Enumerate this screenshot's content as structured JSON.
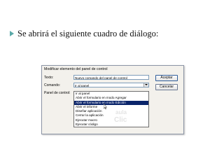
{
  "slide": {
    "bullet_text": "Se abrirá el siguiente cuadro de diálogo:",
    "bullet_color": "#5aa9a8"
  },
  "dialog": {
    "title": "Modificar elemento del panel de control",
    "text_label": "Texto:",
    "text_value": "Nuevo comando del panel de control",
    "command_label": "Comando:",
    "command_value": "Ir al panel",
    "panel_label": "Panel de control:",
    "ok_label": "Aceptar",
    "cancel_label": "Cancelar",
    "dropdown_options": [
      "Ir al panel",
      "Abrir el formulario en modo Agregar",
      "Abrir el formulario en modo Edición",
      "Abrir el informe",
      "Diseñar aplicación",
      "Cerrar la aplicación",
      "Ejecutar macro",
      "Ejecutar código"
    ],
    "selected_index": 2,
    "selection_color": "#0a246a"
  },
  "watermark": {
    "line1": "aula",
    "line2": "Clic",
    "color": "#b0b0b0"
  }
}
